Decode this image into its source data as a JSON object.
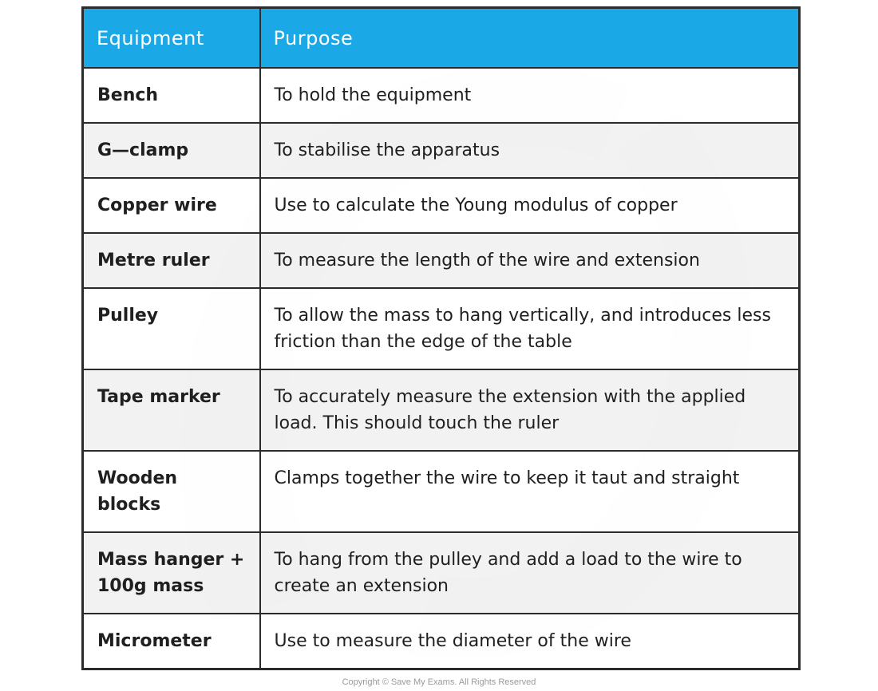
{
  "table": {
    "headers": {
      "equipment": "Equipment",
      "purpose": "Purpose"
    },
    "rows": [
      {
        "equipment": "Bench",
        "purpose": "To hold the equipment"
      },
      {
        "equipment": "G—clamp",
        "purpose": "To stabilise the apparatus"
      },
      {
        "equipment": "Copper wire",
        "purpose": "Use to calculate the Young modulus of copper"
      },
      {
        "equipment": "Metre ruler",
        "purpose": "To measure the length of the wire and extension"
      },
      {
        "equipment": "Pulley",
        "purpose": "To allow the mass to hang vertically, and introduces less friction than the edge of the table"
      },
      {
        "equipment": "Tape marker",
        "purpose": "To accurately measure the extension with the applied load. This should touch the ruler"
      },
      {
        "equipment": "Wooden blocks",
        "purpose": "Clamps together the wire to keep it taut and straight"
      },
      {
        "equipment": "Mass hanger + 100g mass",
        "purpose": "To hang from the pulley and add a load to the wire to create an extension"
      },
      {
        "equipment": "Micrometer",
        "purpose": "Use to measure the diameter of the wire"
      }
    ],
    "header_color": "#1aa9e6"
  },
  "footer": {
    "copyright": "Copyright © Save My Exams. All Rights Reserved"
  }
}
